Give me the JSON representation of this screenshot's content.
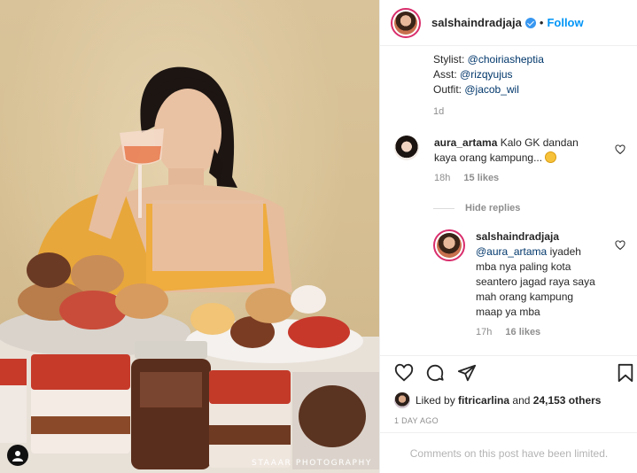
{
  "photo": {
    "credit": "STAAAR PHOTOGRAPHY"
  },
  "header": {
    "username": "salshaindradjaja",
    "separator": "•",
    "follow_label": "Follow"
  },
  "caption": {
    "lines": [
      {
        "label": "Stylist: ",
        "mention": "@choiriasheptia"
      },
      {
        "label": "Asst: ",
        "mention": "@rizqyujus"
      },
      {
        "label": "Outfit: ",
        "mention": "@jacob_wil"
      }
    ],
    "time": "1d"
  },
  "comments": [
    {
      "username": "aura_artama",
      "text": "Kalo GK dandan kaya orang kampung...",
      "time": "18h",
      "likes": "15 likes"
    }
  ],
  "hide_replies_label": "Hide replies",
  "reply": {
    "username": "salshaindradjaja",
    "mention": "@aura_artama",
    "text": " iyadeh mba nya paling kota seantero jagad raya saya mah orang kampung maap ya mba",
    "time": "17h",
    "likes": "16 likes"
  },
  "likes": {
    "prefix": "Liked by ",
    "user": "fitricarlina",
    "middle": " and ",
    "count": "24,153 others"
  },
  "post_date": "1 DAY AGO",
  "comments_limited": "Comments on this post have been limited.",
  "icons": [
    "heart-icon",
    "comment-icon",
    "share-icon",
    "bookmark-icon",
    "verified-badge-icon",
    "user-tag-icon"
  ],
  "colors": {
    "accent": "#0095f6",
    "verified": "#3897f0",
    "story_ring": "#d92e6c"
  }
}
